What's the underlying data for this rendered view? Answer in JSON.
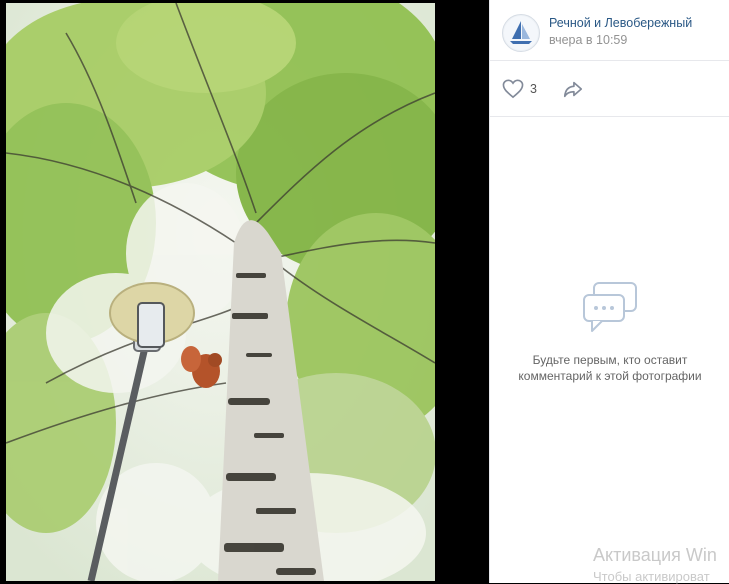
{
  "post": {
    "author": "Речной и Левобережный",
    "time": "вчера в 10:59",
    "likes": "3"
  },
  "comments": {
    "empty_text": "Будьте первым, кто оставит комментарий к этой фотографии"
  },
  "watermark": {
    "title": "Активация Win",
    "subtitle": "Чтобы активироват"
  },
  "icons": {
    "like": "heart-icon",
    "share": "share-arrow-icon",
    "empty": "comment-bubble-icon"
  },
  "colors": {
    "link": "#2a5885",
    "muted": "#939393"
  }
}
